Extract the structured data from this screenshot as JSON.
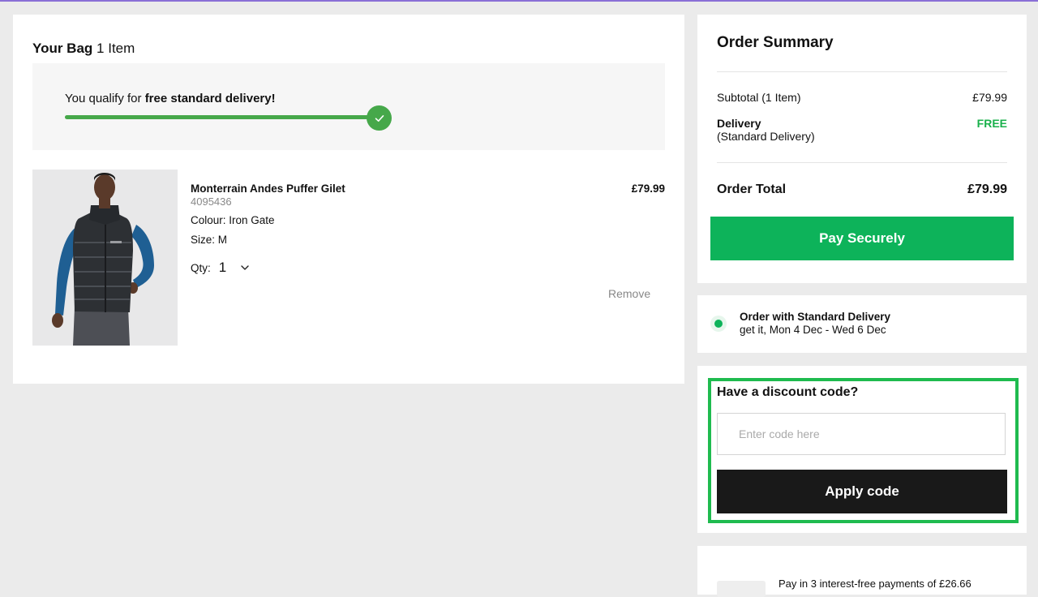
{
  "colors": {
    "accent_green": "#0db35a",
    "progress_green": "#46a84a",
    "highlight_border": "#1fbb4f",
    "dark_button": "#191919",
    "page_bg": "#ebebeb"
  },
  "bag": {
    "title": "Your Bag",
    "count": "1 Item",
    "delivery_banner": {
      "prefix": "You qualify for ",
      "emphasis": "free standard delivery!",
      "progress_fraction": 1.0,
      "icon": "check-icon"
    },
    "item": {
      "name": "Monterrain Andes Puffer Gilet",
      "code": "4095436",
      "colour": "Colour: Iron Gate",
      "size": "Size: M",
      "qty_label": "Qty:",
      "qty_value": "1",
      "price": "£79.99",
      "remove_label": "Remove"
    }
  },
  "summary": {
    "title": "Order Summary",
    "subtotal_label": "Subtotal (1 Item)",
    "subtotal_value": "£79.99",
    "delivery_label": "Delivery",
    "delivery_sublabel": "(Standard Delivery)",
    "delivery_value": "FREE",
    "total_label": "Order Total",
    "total_value": "£79.99",
    "pay_button": "Pay Securely"
  },
  "shipping": {
    "option_title": "Order with Standard Delivery",
    "option_detail": "get it, Mon 4 Dec - Wed 6 Dec"
  },
  "discount": {
    "title": "Have a discount code?",
    "placeholder": "Enter code here",
    "value": "",
    "apply_button": "Apply code"
  },
  "installments": {
    "text": "Pay in 3 interest-free payments of £26.66"
  }
}
